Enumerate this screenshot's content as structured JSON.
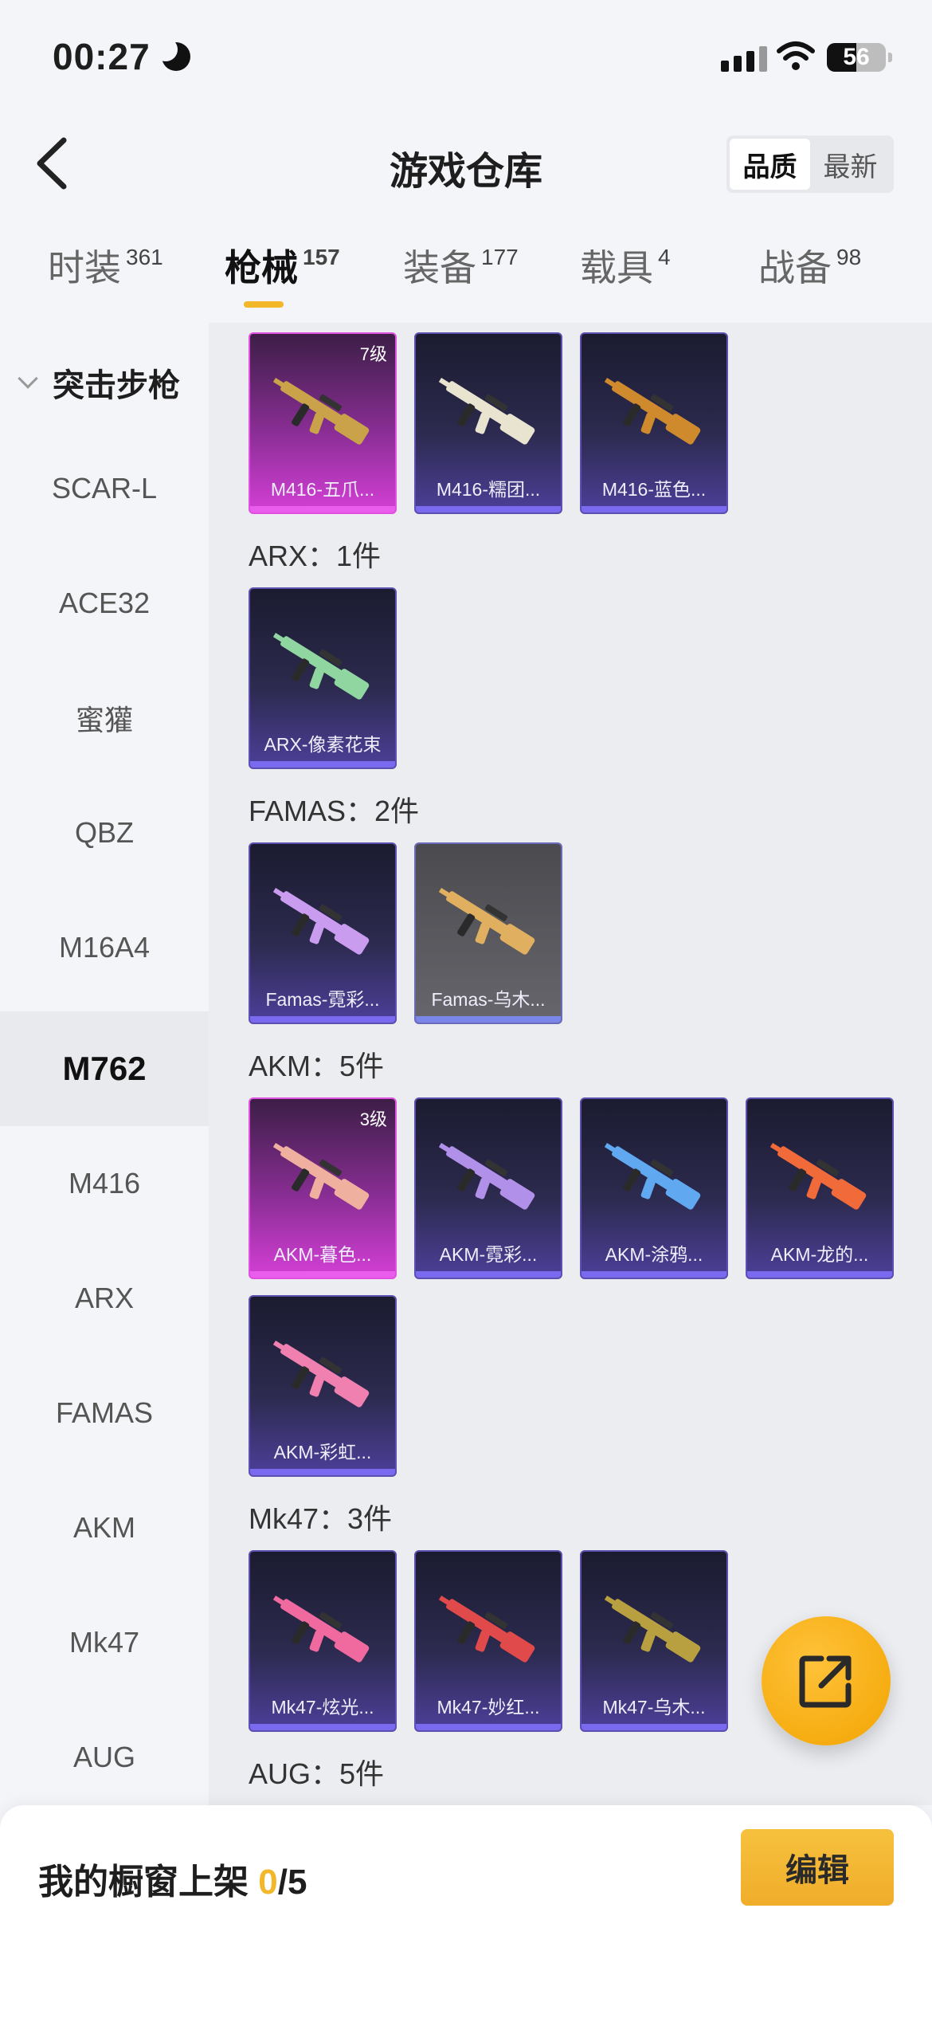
{
  "status_bar": {
    "time": "00:27",
    "battery": "56"
  },
  "header": {
    "title": "游戏仓库",
    "sort": [
      "品质",
      "最新"
    ],
    "sort_active": 0
  },
  "tabs": [
    {
      "label": "时装",
      "count": "361"
    },
    {
      "label": "枪械",
      "count": "157"
    },
    {
      "label": "装备",
      "count": "177"
    },
    {
      "label": "载具",
      "count": "4"
    },
    {
      "label": "战备",
      "count": "98"
    }
  ],
  "tab_active": 1,
  "sidebar": {
    "group": "突击步枪",
    "items": [
      "SCAR-L",
      "ACE32",
      "蜜獾",
      "QBZ",
      "M16A4",
      "M762",
      "M416",
      "ARX",
      "FAMAS",
      "AKM",
      "Mk47",
      "AUG"
    ],
    "active": "M762"
  },
  "sections": [
    {
      "title": "",
      "cards": [
        {
          "name": "M416-五爪...",
          "rarity": "pink",
          "level": "7级"
        },
        {
          "name": "M416-糯团...",
          "rarity": "purple",
          "level": ""
        },
        {
          "name": "M416-蓝色...",
          "rarity": "purple",
          "level": ""
        }
      ]
    },
    {
      "title": "ARX：1件",
      "cards": [
        {
          "name": "ARX-像素花束",
          "rarity": "purple",
          "level": ""
        }
      ]
    },
    {
      "title": "FAMAS：2件",
      "cards": [
        {
          "name": "Famas-霓彩...",
          "rarity": "purple",
          "level": ""
        },
        {
          "name": "Famas-乌木...",
          "rarity": "gray",
          "level": ""
        }
      ]
    },
    {
      "title": "AKM：5件",
      "cards": [
        {
          "name": "AKM-暮色...",
          "rarity": "pink",
          "level": "3级"
        },
        {
          "name": "AKM-霓彩...",
          "rarity": "purple",
          "level": ""
        },
        {
          "name": "AKM-涂鸦...",
          "rarity": "purple",
          "level": ""
        },
        {
          "name": "AKM-龙的...",
          "rarity": "purple",
          "level": ""
        },
        {
          "name": "AKM-彩虹...",
          "rarity": "purple",
          "level": ""
        }
      ]
    },
    {
      "title": "Mk47：3件",
      "cards": [
        {
          "name": "Mk47-炫光...",
          "rarity": "purple",
          "level": ""
        },
        {
          "name": "Mk47-妙红...",
          "rarity": "purple",
          "level": ""
        },
        {
          "name": "Mk47-乌木...",
          "rarity": "purple",
          "level": ""
        }
      ]
    },
    {
      "title": "AUG：5件",
      "cards": []
    }
  ],
  "bottom": {
    "shelf_label": "我的橱窗上架 ",
    "shelf_count": "0",
    "shelf_total": "/5",
    "edit_label": "编辑"
  },
  "icons": {
    "back": "chevron-left-icon",
    "share": "share-external-icon"
  },
  "colors": {
    "accent": "#f3b72a",
    "legendary": "#d43fd6",
    "epic": "#5b4fb0"
  }
}
